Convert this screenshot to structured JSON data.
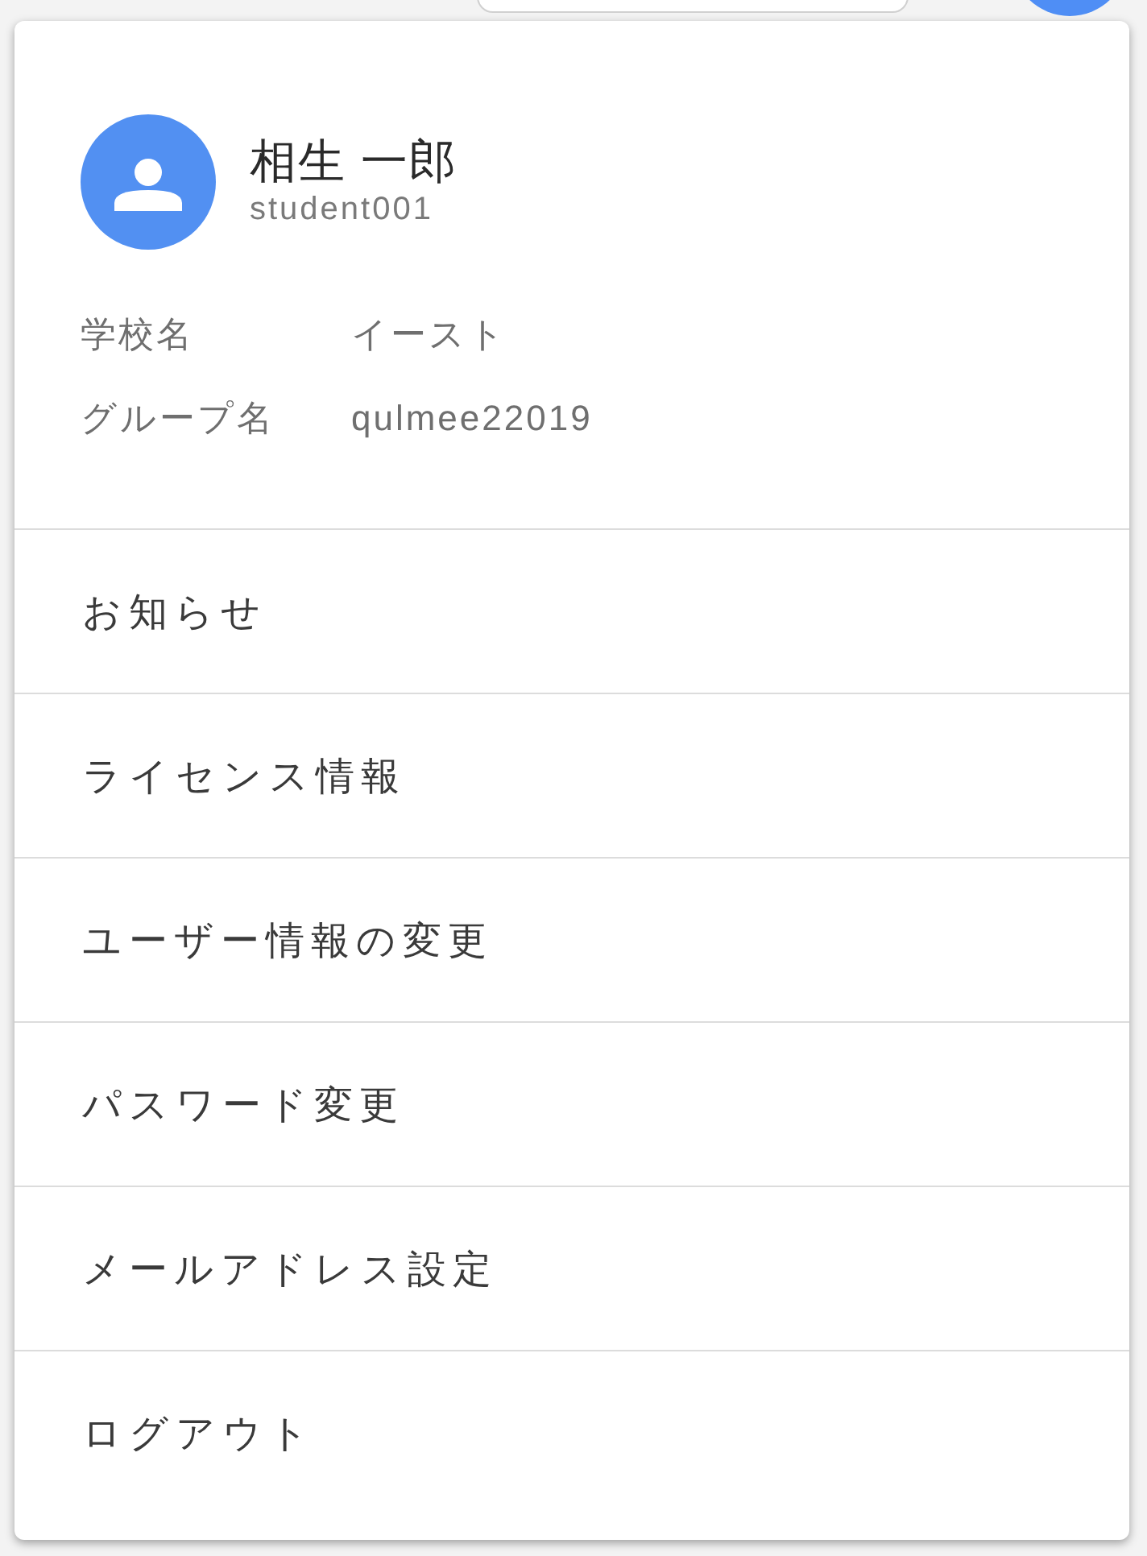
{
  "user": {
    "name": "相生 一郎",
    "id": "student001"
  },
  "info": [
    {
      "label": "学校名",
      "value": "イースト"
    },
    {
      "label": "グループ名",
      "value": "qulmee22019"
    }
  ],
  "menu": [
    {
      "label": "お知らせ"
    },
    {
      "label": "ライセンス情報"
    },
    {
      "label": "ユーザー情報の変更"
    },
    {
      "label": "パスワード変更"
    },
    {
      "label": "メールアドレス設定"
    },
    {
      "label": "ログアウト"
    }
  ]
}
